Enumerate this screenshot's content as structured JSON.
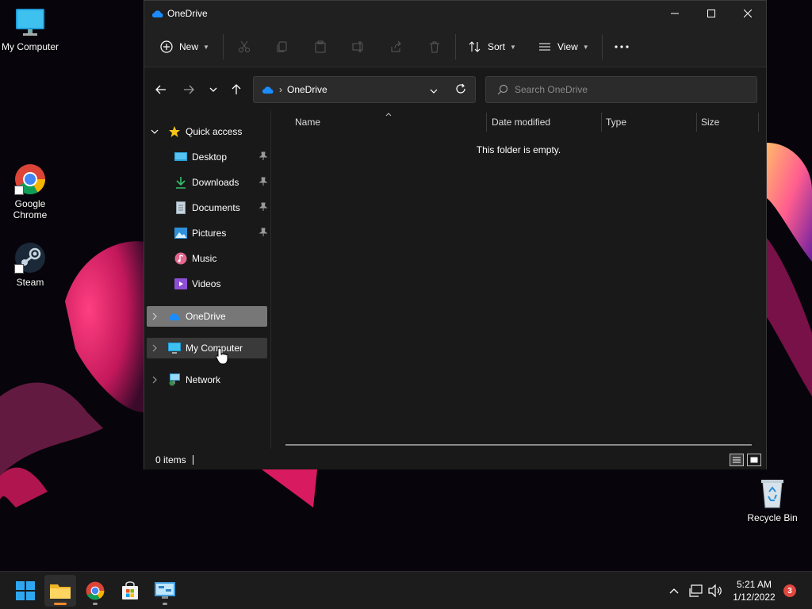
{
  "desktop": {
    "icons": [
      {
        "label": "My Computer",
        "icon": "monitor-icon"
      },
      {
        "label": "Google\nChrome",
        "icon": "chrome-icon"
      },
      {
        "label": "Steam",
        "icon": "steam-icon"
      },
      {
        "label": "Recycle Bin",
        "icon": "recycle-bin-icon"
      }
    ]
  },
  "window": {
    "title": "OneDrive",
    "title_icon": "onedrive-cloud-icon",
    "controls": {
      "minimize": "minimize-icon",
      "maximize": "maximize-icon",
      "close": "close-icon"
    }
  },
  "commandbar": {
    "new_label": "New",
    "actions": [
      "cut-icon",
      "copy-icon",
      "paste-icon",
      "rename-icon",
      "share-icon",
      "delete-icon"
    ],
    "sort_label": "Sort",
    "view_label": "View",
    "more_icon": "more-icon"
  },
  "navigation": {
    "buttons": [
      "back-arrow-icon",
      "forward-arrow-icon",
      "recent-chevron-icon",
      "up-arrow-icon"
    ],
    "address": {
      "crumb": "OneDrive"
    },
    "search": {
      "placeholder": "Search OneDrive"
    }
  },
  "sidebar": {
    "quick_access": "Quick access",
    "quick_items": [
      {
        "label": "Desktop",
        "icon": "desktop-folder-icon",
        "pinned": true
      },
      {
        "label": "Downloads",
        "icon": "downloads-icon",
        "pinned": true
      },
      {
        "label": "Documents",
        "icon": "documents-icon",
        "pinned": true
      },
      {
        "label": "Pictures",
        "icon": "pictures-icon",
        "pinned": true
      },
      {
        "label": "Music",
        "icon": "music-icon",
        "pinned": false
      },
      {
        "label": "Videos",
        "icon": "videos-icon",
        "pinned": false
      }
    ],
    "roots": [
      {
        "label": "OneDrive",
        "icon": "onedrive-cloud-icon",
        "state": "selected"
      },
      {
        "label": "My Computer",
        "icon": "monitor-icon",
        "state": "hover"
      },
      {
        "label": "Network",
        "icon": "network-icon",
        "state": "normal"
      }
    ]
  },
  "content": {
    "columns": [
      "Name",
      "Date modified",
      "Type",
      "Size"
    ],
    "sorted_column": "Name",
    "empty_message": "This folder is empty."
  },
  "statusbar": {
    "item_count": "0 items",
    "view_modes": [
      "details-view-icon",
      "large-icons-view-icon"
    ],
    "active_view": "details-view-icon"
  },
  "taskbar": {
    "apps": [
      "start-icon",
      "file-explorer-icon",
      "chrome-icon",
      "store-icon",
      "control-panel-icon"
    ],
    "tray": [
      "show-hidden-icons-icon",
      "network-status-icon",
      "volume-icon"
    ],
    "time": "5:21 AM",
    "date": "1/12/2022",
    "notification_count": "3"
  },
  "colors": {
    "window_bg": "#191919",
    "titlebar_bg": "#202020",
    "accent": "#0078d4",
    "selected_bg": "#777777",
    "taskbar_bg": "#1c1c1c",
    "notification_badge": "#e0473f"
  }
}
